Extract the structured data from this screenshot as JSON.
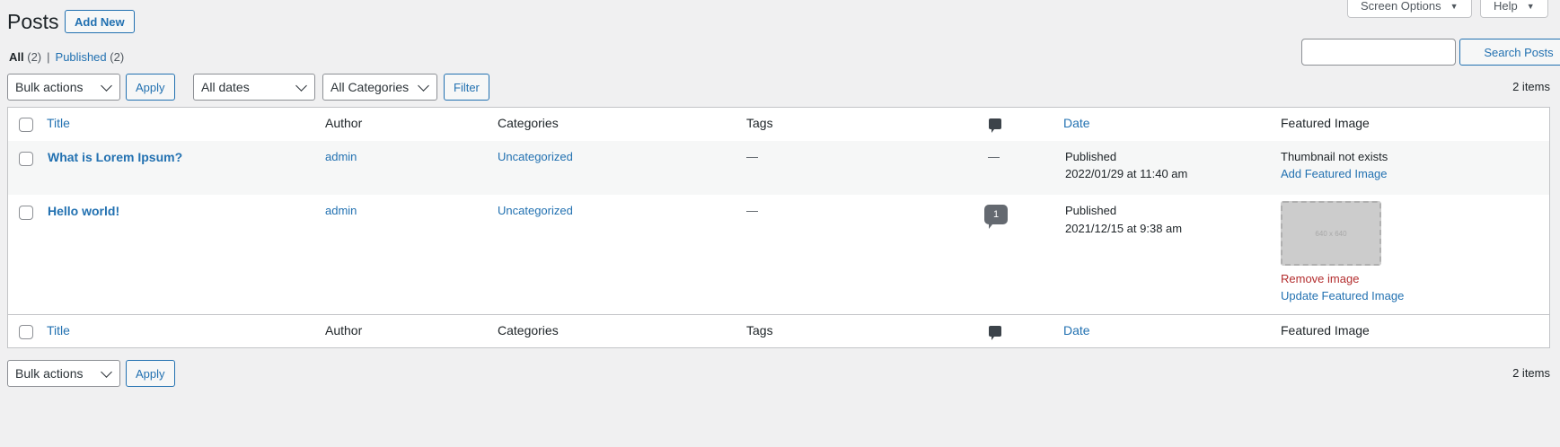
{
  "header": {
    "title": "Posts",
    "add_new": "Add New",
    "screen_options": "Screen Options",
    "help": "Help",
    "tab_arrow": "▼"
  },
  "views": {
    "all_label": "All",
    "all_count": "(2)",
    "separator": "|",
    "published_label": "Published",
    "published_count": "(2)"
  },
  "search": {
    "value": "",
    "button": "Search Posts"
  },
  "filters": {
    "bulk_actions": "Bulk actions",
    "apply": "Apply",
    "dates": "All dates",
    "categories": "All Categories",
    "filter": "Filter",
    "items_count": "2 items"
  },
  "columns": {
    "title": "Title",
    "author": "Author",
    "categories": "Categories",
    "tags": "Tags",
    "date": "Date",
    "featured_image": "Featured Image"
  },
  "posts": [
    {
      "title": "What is Lorem Ipsum?",
      "author": "admin",
      "category": "Uncategorized",
      "tags": "—",
      "comments": "—",
      "status": "Published",
      "date": "2022/01/29 at 11:40 am",
      "featured_note": "Thumbnail not exists",
      "featured_action": "Add Featured Image"
    },
    {
      "title": "Hello world!",
      "author": "admin",
      "category": "Uncategorized",
      "tags": "—",
      "comments": "1",
      "status": "Published",
      "date": "2021/12/15 at 9:38 am",
      "thumbnail_text": "640 x 640",
      "remove_action": "Remove image",
      "update_action": "Update Featured Image"
    }
  ],
  "bottom": {
    "bulk_actions": "Bulk actions",
    "apply": "Apply",
    "items_count": "2 items"
  }
}
